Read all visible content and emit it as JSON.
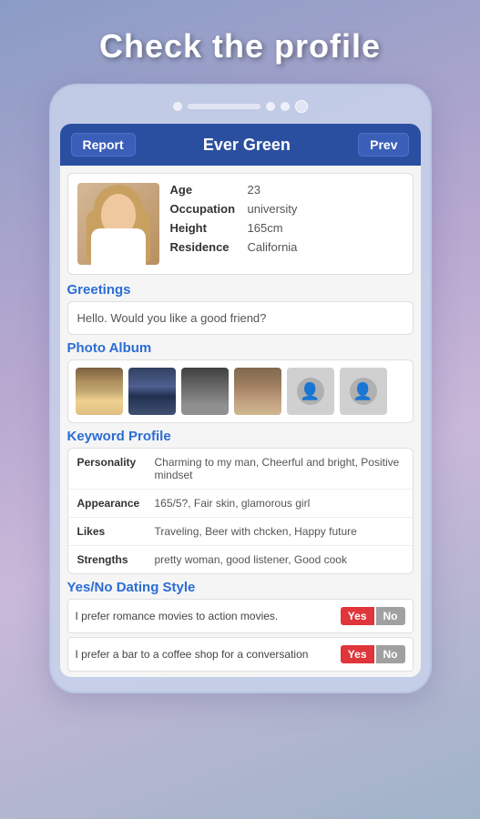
{
  "page": {
    "title": "Check the profile"
  },
  "header": {
    "report_label": "Report",
    "name_label": "Ever Green",
    "prev_label": "Prev"
  },
  "profile": {
    "age_label": "Age",
    "age_value": "23",
    "occupation_label": "Occupation",
    "occupation_value": "university",
    "height_label": "Height",
    "height_value": "165cm",
    "residence_label": "Residence",
    "residence_value": "California"
  },
  "greetings": {
    "section_label": "Greetings",
    "text": "Hello. Would you like a good friend?"
  },
  "photo_album": {
    "section_label": "Photo Album"
  },
  "keyword_profile": {
    "section_label": "Keyword Profile",
    "personality_label": "Personality",
    "personality_value": "Charming to my man, Cheerful and bright, Positive mindset",
    "appearance_label": "Appearance",
    "appearance_value": "165/5?, Fair skin, glamorous girl",
    "likes_label": "Likes",
    "likes_value": "Traveling, Beer with chcken, Happy future",
    "strengths_label": "Strengths",
    "strengths_value": "pretty woman, good listener, Good cook"
  },
  "yesno": {
    "section_label": "Yes/No Dating Style",
    "row1_text": "I prefer romance movies to action movies.",
    "row1_yes": "Yes",
    "row1_no": "No",
    "row2_text": "I prefer a bar to a coffee shop for a conversation",
    "row2_yes": "Yes",
    "row2_no": "No"
  }
}
